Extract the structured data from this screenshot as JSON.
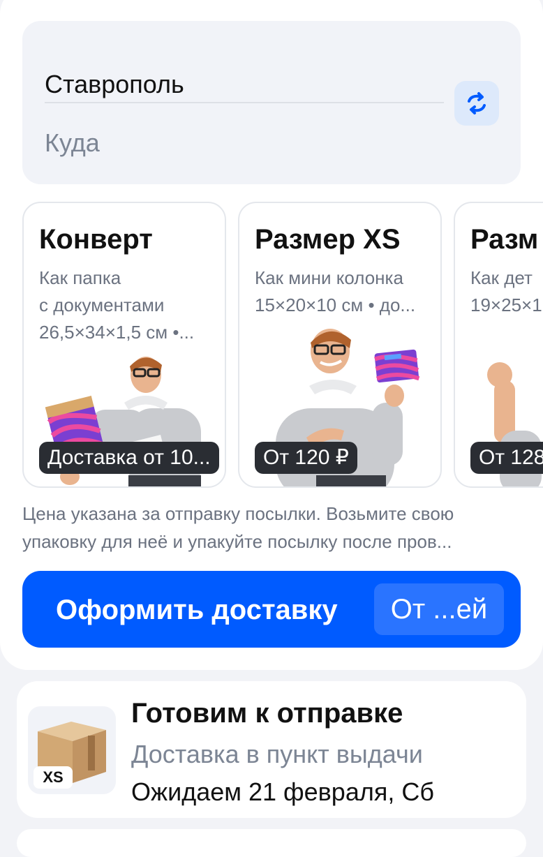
{
  "route": {
    "from": "Ставрополь",
    "to_placeholder": "Куда",
    "swap_icon": "swap-arrows-icon"
  },
  "cards": [
    {
      "title": "Конверт",
      "desc_lines": [
        "Как папка",
        "с документами",
        "26,5×34×1,5 см •..."
      ],
      "price": "Доставка от 10..."
    },
    {
      "title": "Размер XS",
      "desc_lines": [
        "Как мини колонка",
        "15×20×10 см • до..."
      ],
      "price": "От 120 ₽"
    },
    {
      "title": "Разм",
      "desc_lines": [
        "Как дет",
        "19×25×1"
      ],
      "price": "От 128"
    }
  ],
  "note": {
    "lines": [
      "Цена указана за отправку посылки. Возьмите свою",
      "упаковку для неё и упакуйте посылку после пров..."
    ]
  },
  "cta": {
    "label": "Оформить доставку",
    "price": "От ...ей"
  },
  "order": {
    "size_badge": "XS",
    "title": "Готовим к отправке",
    "subtitle": "Доставка в пункт выдачи",
    "date": "Ожидаем 21 февраля, Сб"
  },
  "colors": {
    "accent": "#005bff",
    "chip": "#2a2d33",
    "muted": "#6b7280"
  }
}
